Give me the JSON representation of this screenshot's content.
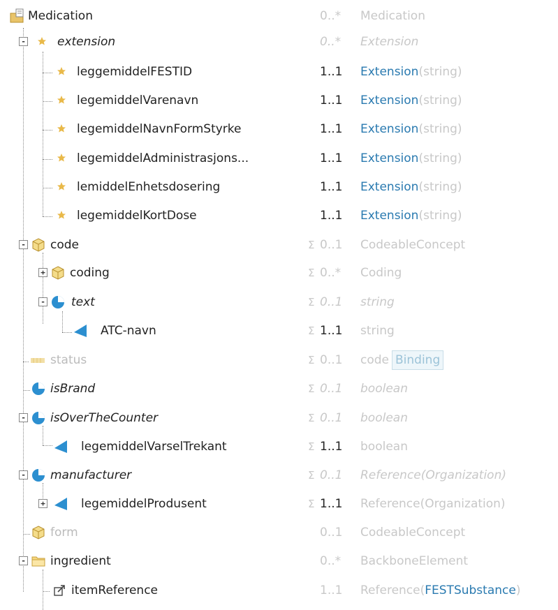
{
  "colors": {
    "link": "#2a7ab0",
    "dim": "#c8c8c8",
    "icon_blue": "#2c8fd0",
    "icon_gold": "#e2b04a"
  },
  "rows": [
    {
      "name": "Medication",
      "icon": "root-folder-icon",
      "toggle": "",
      "sigma": "",
      "card": "0..*",
      "type": "Medication"
    },
    {
      "name": "extension",
      "icon": "star-icon",
      "toggle": "-",
      "sigma": "",
      "card": "0..*",
      "type": "Extension"
    },
    {
      "name": "leggemiddelFESTID",
      "icon": "star-icon",
      "toggle": "",
      "sigma": "",
      "card": "1..1",
      "type": "Extension",
      "type_paren": "string"
    },
    {
      "name": "legemiddelVarenavn",
      "icon": "star-icon",
      "toggle": "",
      "sigma": "",
      "card": "1..1",
      "type": "Extension",
      "type_paren": "string"
    },
    {
      "name": "legemiddelNavnFormStyrke",
      "icon": "star-icon",
      "toggle": "",
      "sigma": "",
      "card": "1..1",
      "type": "Extension",
      "type_paren": "string"
    },
    {
      "name": "legemiddelAdministrasjons...",
      "icon": "star-icon",
      "toggle": "",
      "sigma": "",
      "card": "1..1",
      "type": "Extension",
      "type_paren": "string"
    },
    {
      "name": "lemiddelEnhetsdosering",
      "icon": "star-icon",
      "toggle": "",
      "sigma": "",
      "card": "1..1",
      "type": "Extension",
      "type_paren": "string"
    },
    {
      "name": "legemiddelKortDose",
      "icon": "star-icon",
      "toggle": "",
      "sigma": "",
      "card": "1..1",
      "type": "Extension",
      "type_paren": "string"
    },
    {
      "name": "code",
      "icon": "cube-icon",
      "toggle": "-",
      "sigma": "Σ",
      "card": "0..1",
      "type": "CodeableConcept"
    },
    {
      "name": "coding",
      "icon": "cube-icon",
      "toggle": "+",
      "sigma": "Σ",
      "card": "0..*",
      "type": "Coding"
    },
    {
      "name": "text",
      "icon": "primitive-icon",
      "toggle": "-",
      "sigma": "Σ",
      "card": "0..1",
      "type": "string"
    },
    {
      "name": "ATC-navn",
      "icon": "slice-icon",
      "toggle": "",
      "sigma": "Σ",
      "card": "1..1",
      "type": "string"
    },
    {
      "name": "status",
      "icon": "code-icon",
      "toggle": "",
      "sigma": "Σ",
      "card": "0..1",
      "type": "code",
      "binding": "Binding"
    },
    {
      "name": "isBrand",
      "icon": "primitive-icon",
      "toggle": "",
      "sigma": "Σ",
      "card": "0..1",
      "type": "boolean"
    },
    {
      "name": "isOverTheCounter",
      "icon": "primitive-icon",
      "toggle": "-",
      "sigma": "Σ",
      "card": "0..1",
      "type": "boolean"
    },
    {
      "name": "legemiddelVarselTrekant",
      "icon": "slice-icon",
      "toggle": "",
      "sigma": "Σ",
      "card": "1..1",
      "type": "boolean"
    },
    {
      "name": "manufacturer",
      "icon": "primitive-icon",
      "toggle": "-",
      "sigma": "Σ",
      "card": "0..1",
      "type": "Reference(Organization)"
    },
    {
      "name": "legemiddelProdusent",
      "icon": "slice-icon",
      "toggle": "+",
      "sigma": "Σ",
      "card": "1..1",
      "type": "Reference(Organization)"
    },
    {
      "name": "form",
      "icon": "cube-icon",
      "toggle": "",
      "sigma": "",
      "card": "0..1",
      "type": "CodeableConcept"
    },
    {
      "name": "ingredient",
      "icon": "folder-icon",
      "toggle": "-",
      "sigma": "",
      "card": "0..*",
      "type": "BackboneElement"
    },
    {
      "name": "itemReference",
      "icon": "reference-icon",
      "toggle": "",
      "sigma": "",
      "card": "1..1",
      "type": "Reference",
      "type_paren": "FESTSubstance"
    }
  ]
}
